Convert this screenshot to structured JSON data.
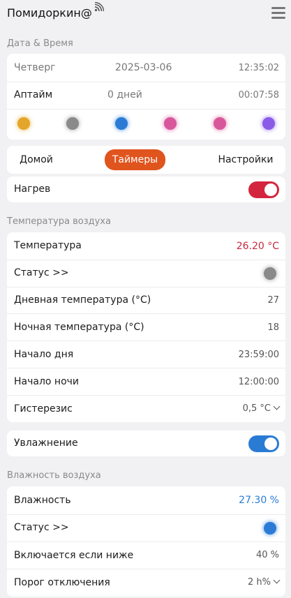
{
  "app": {
    "title": "Помидоркин@"
  },
  "datetime_section": {
    "label": "Дата & Время",
    "day": "Четверг",
    "date": "2025-03-06",
    "time": "12:35:02",
    "uptime_label": "Аптайм",
    "uptime_days": "0 дней",
    "uptime_time": "00:07:58",
    "status_dots": [
      {
        "name": "status-dot-orange",
        "color": "#e3a52a"
      },
      {
        "name": "status-dot-gray",
        "color": "#8a8a8a"
      },
      {
        "name": "status-dot-blue",
        "color": "#2b7bd6"
      },
      {
        "name": "status-dot-pink",
        "color": "#d9569c"
      },
      {
        "name": "status-dot-magenta",
        "color": "#d8579a"
      },
      {
        "name": "status-dot-purple",
        "color": "#8b5be8"
      }
    ]
  },
  "tabs": [
    {
      "label": "Домой",
      "active": false
    },
    {
      "label": "Таймеры",
      "active": true
    },
    {
      "label": "Настройки",
      "active": false
    }
  ],
  "heating": {
    "label": "Нагрев",
    "enabled": true,
    "color": "#d4253f"
  },
  "air_temp_section": {
    "label": "Температура воздуха",
    "temperature_label": "Температура",
    "temperature_value": "26.20 °C",
    "temperature_color": "#c8283e",
    "status_label": "Статус >>",
    "status_color": "#8a8a8a",
    "day_temp_label": "Дневная температура (°C)",
    "day_temp_value": "27",
    "night_temp_label": "Ночная температура (°C)",
    "night_temp_value": "18",
    "day_start_label": "Начало дня",
    "day_start_value": "23:59:00",
    "night_start_label": "Начало ночи",
    "night_start_value": "12:00:00",
    "hysteresis_label": "Гистерезис",
    "hysteresis_value": "0,5 °C"
  },
  "humidifier": {
    "label": "Увлажнение",
    "enabled": true,
    "color": "#2a7bd4"
  },
  "air_humidity_section": {
    "label": "Влажность воздуха",
    "humidity_label": "Влажность",
    "humidity_value": "27.30 %",
    "humidity_color": "#2a7bd4",
    "status_label": "Статус >>",
    "status_color": "#2b7bd6",
    "on_below_label": "Включается если ниже",
    "on_below_value": "40 %",
    "off_threshold_label": "Порог отключения",
    "off_threshold_value": "2 h%"
  }
}
